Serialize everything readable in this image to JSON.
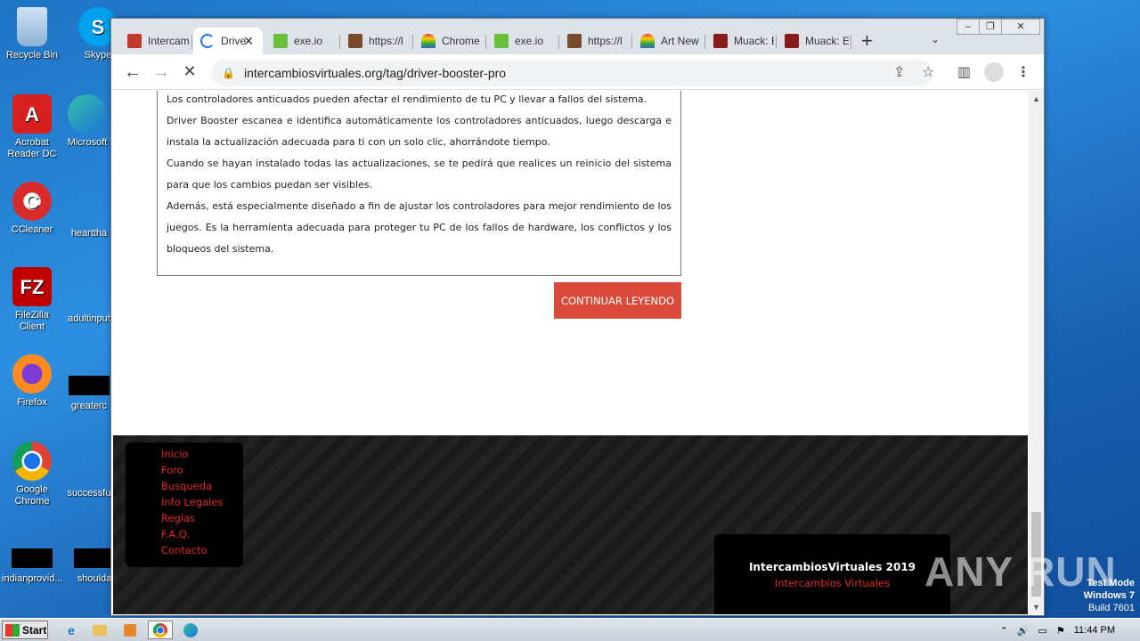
{
  "desktop": {
    "icons": [
      {
        "label": "Recycle Bin"
      },
      {
        "label": "Skype"
      },
      {
        "label": "Acrobat Reader DC"
      },
      {
        "label": "Microsoft"
      },
      {
        "label": "CCleaner"
      },
      {
        "label": "hearttha"
      },
      {
        "label": "FileZilla Client"
      },
      {
        "label": "adultinput"
      },
      {
        "label": "Firefox"
      },
      {
        "label": "greaterc"
      },
      {
        "label": "Google Chrome"
      },
      {
        "label": "successfu"
      },
      {
        "label": "indianprovid..."
      },
      {
        "label": "shoulda"
      }
    ]
  },
  "browser": {
    "tabs": [
      {
        "title": "Intercam",
        "active": false
      },
      {
        "title": "Drive",
        "active": true
      },
      {
        "title": "exe.io",
        "active": false
      },
      {
        "title": "https://l",
        "active": false
      },
      {
        "title": "Chrome",
        "active": false
      },
      {
        "title": "exe.io",
        "active": false
      },
      {
        "title": "https://l",
        "active": false
      },
      {
        "title": "Art New",
        "active": false
      },
      {
        "title": "Muack: E",
        "active": false
      },
      {
        "title": "Muack: E",
        "active": false
      }
    ],
    "new_tab": "+",
    "url": "intercambiosvirtuales.org/tag/driver-booster-pro"
  },
  "page": {
    "article_paragraphs": [
      "Los controladores anticuados pueden afectar el rendimiento de tu PC y llevar a fallos del sistema.",
      "Driver Booster escanea e identifica automáticamente los controladores anticuados, luego descarga e instala la actualización adecuada para ti con un solo clic, ahorrándote tiempo.",
      "Cuando se hayan instalado todas las actualizaciones, se te pedirá que realices un reinicio del sistema para que los cambios puedan ser visibles.",
      "Además, está especialmente diseñado a fin de ajustar los controladores para mejor rendimiento de los juegos. Es la herramienta adecuada para proteger tu PC de los fallos de hardware, los conflictos y los bloqueos del sistema."
    ],
    "continue_button": "CONTINUAR LEYENDO",
    "footer_links": [
      "Inicio",
      "Foro",
      "Busqueda",
      "Info Legales",
      "Reglas",
      "F.A.Q.",
      "Contacto"
    ],
    "footer_brand_title": "IntercambiosVirtuales 2019",
    "footer_brand_sub": "Intercambios Virtuales"
  },
  "watermark": {
    "text": "ANY RUN",
    "test_mode": "Test Mode",
    "os": "Windows 7",
    "build": "Build 7601"
  },
  "taskbar": {
    "start_label": "Start",
    "clock": "11:44 PM"
  }
}
